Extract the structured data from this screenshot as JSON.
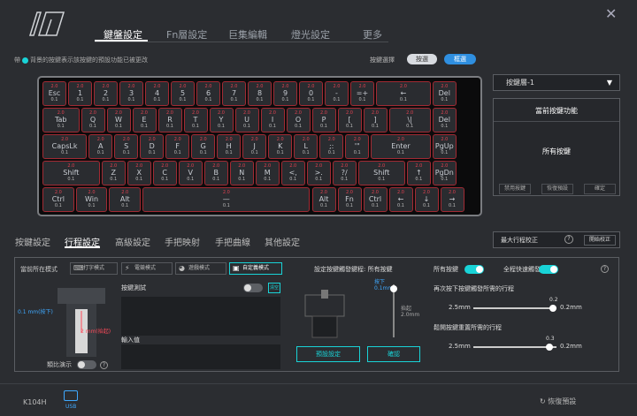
{
  "nav": {
    "tabs": [
      {
        "label": "鍵盤設定",
        "active": true
      },
      {
        "label": "Fn層設定"
      },
      {
        "label": "巨集編輯"
      },
      {
        "label": "燈光設定"
      },
      {
        "label": "更多"
      }
    ]
  },
  "hint": {
    "prefix": "帶",
    "text": "背景的按鍵表示該按鍵的預設功能已被更改"
  },
  "key_select": {
    "label": "按鍵選擇",
    "pill_a": "按選",
    "pill_b": "框選"
  },
  "keyboard": {
    "travel_top": "2.0",
    "travel_bottom": "0.1",
    "rows": [
      [
        "Esc",
        "1",
        "2",
        "3",
        "4",
        "5",
        "6",
        "7",
        "8",
        "9",
        "0",
        "-",
        "=+",
        "←",
        "Del"
      ],
      [
        "Tab",
        "Q",
        "W",
        "E",
        "R",
        "T",
        "Y",
        "U",
        "I",
        "O",
        "P",
        "[",
        "]",
        "\\|",
        "Del"
      ],
      [
        "CapsLk",
        "A",
        "S",
        "D",
        "F",
        "G",
        "H",
        "J",
        "K",
        "L",
        ";:",
        "'\"",
        "Enter",
        "PgUp"
      ],
      [
        "Shift",
        "Z",
        "X",
        "C",
        "V",
        "B",
        "N",
        "M",
        "<,",
        ">.",
        "?/",
        "Shift",
        "↑",
        "PgDn"
      ],
      [
        "Ctrl",
        "Win",
        "Alt",
        "—",
        "Alt",
        "Fn",
        "Ctrl",
        "←",
        "↓",
        "→"
      ]
    ]
  },
  "layer": {
    "selected": "按鍵層-1"
  },
  "current_key": {
    "title": "當前按鍵功能",
    "value": "所有按鍵",
    "btn_disable": "禁用按鍵",
    "btn_restore": "恢復預設",
    "btn_confirm": "確定"
  },
  "subtabs": [
    {
      "label": "按鍵設定"
    },
    {
      "label": "行程設定",
      "active": true
    },
    {
      "label": "高級設定"
    },
    {
      "label": "手把映射"
    },
    {
      "label": "手把曲線"
    },
    {
      "label": "其他設定"
    }
  ],
  "max_cal": {
    "label": "最大行程校正",
    "help": "?",
    "button": "開始校正"
  },
  "mode": {
    "label": "當前所在模式",
    "buttons": [
      {
        "label": "打字模式",
        "icon": "keyboard-icon"
      },
      {
        "label": "電競模式",
        "icon": "lightning-icon"
      },
      {
        "label": "遊戲模式",
        "icon": "pacman-icon"
      },
      {
        "label": "自定義模式",
        "icon": "custom-icon",
        "active": true
      }
    ]
  },
  "switch_demo": {
    "top": "0.1 mm(按下)",
    "bottom": "2 mm(抬起)",
    "sim_label": "類比演示",
    "help": "?"
  },
  "test": {
    "label": "按鍵測試",
    "input_label": "輸入值",
    "mini": "清空"
  },
  "trigger": {
    "label": "設定按鍵觸發鍵程: 所有按鍵",
    "down": "按下",
    "down_value": "0.1mm",
    "bottom": "抬起",
    "bottom_value": "2.0mm",
    "reset_btn": "預設設定",
    "confirm_btn": "確認",
    "down_level": 0.02
  },
  "rt": {
    "all_keys": "所有按鍵",
    "rt_label": "全程快速觸發",
    "help": "?",
    "press": {
      "label": "再次按下按鍵觸發所需的行程",
      "min": "2.5mm",
      "max": "0.2mm",
      "value": "0.2"
    },
    "release": {
      "label": "鬆開按鍵重置所需的行程",
      "min": "2.5mm",
      "max": "0.2mm",
      "value": "0.3"
    }
  },
  "footer": {
    "model": "K104H",
    "usb": "USB",
    "reset": "恢復預設"
  }
}
